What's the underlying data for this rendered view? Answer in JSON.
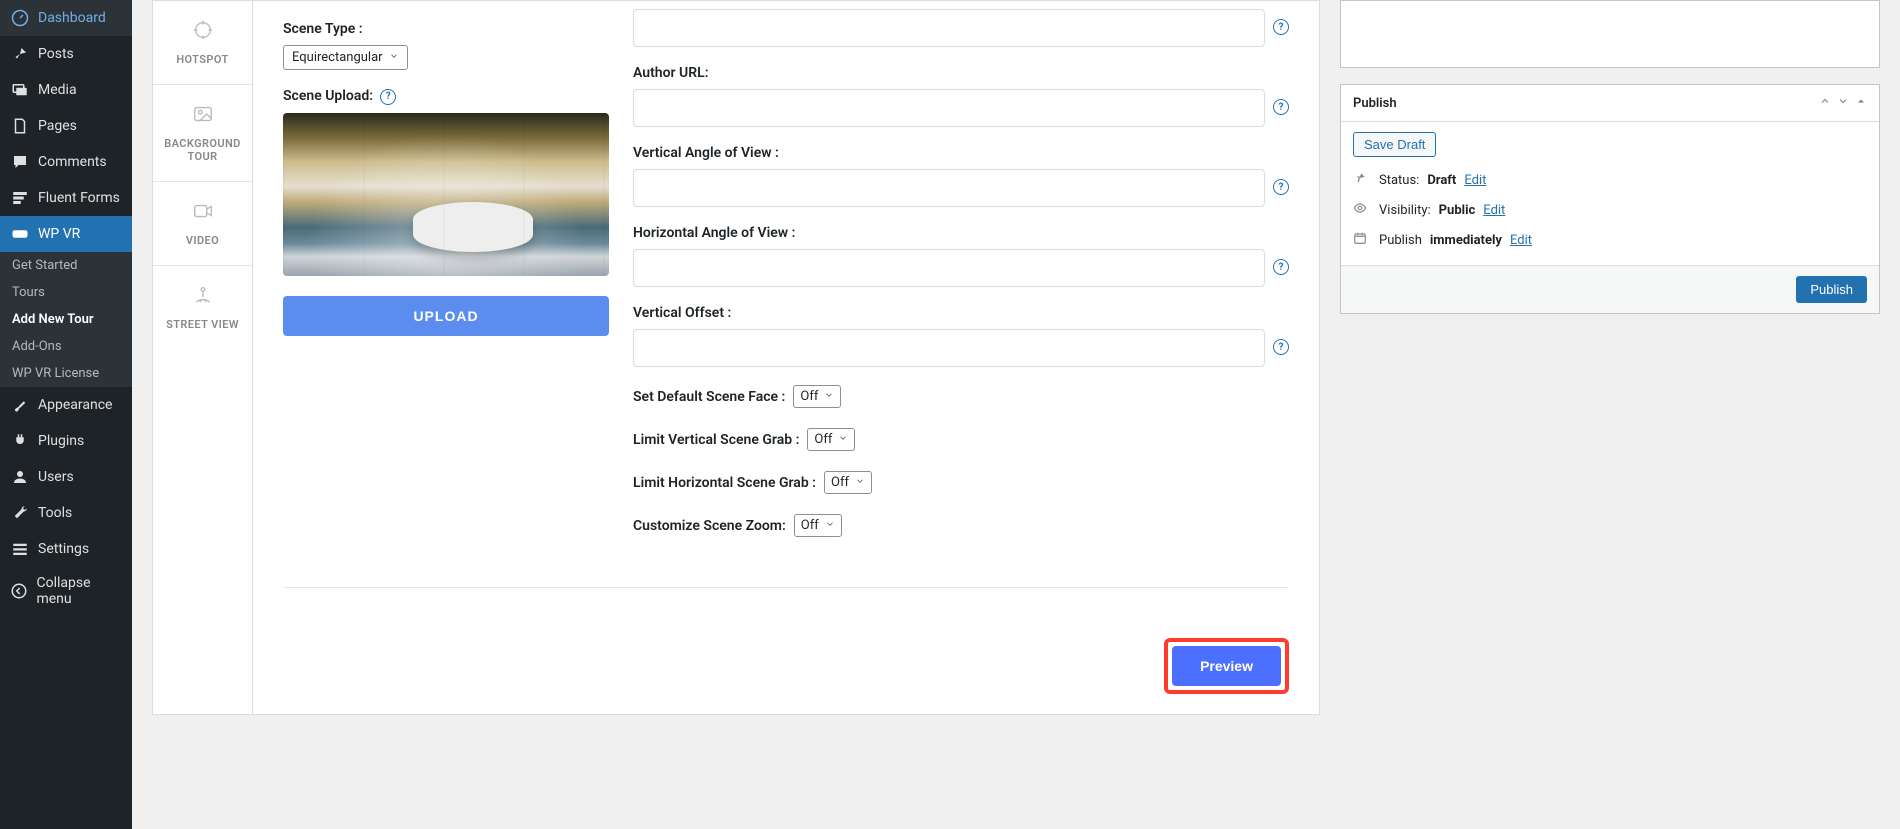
{
  "sidebar": {
    "items": [
      {
        "label": "Dashboard"
      },
      {
        "label": "Posts"
      },
      {
        "label": "Media"
      },
      {
        "label": "Pages"
      },
      {
        "label": "Comments"
      },
      {
        "label": "Fluent Forms"
      },
      {
        "label": "WP VR"
      },
      {
        "label": "Appearance"
      },
      {
        "label": "Plugins"
      },
      {
        "label": "Users"
      },
      {
        "label": "Tools"
      },
      {
        "label": "Settings"
      },
      {
        "label": "Collapse menu"
      }
    ],
    "wpvr_sub": [
      {
        "label": "Get Started"
      },
      {
        "label": "Tours"
      },
      {
        "label": "Add New Tour"
      },
      {
        "label": "Add-Ons"
      },
      {
        "label": "WP VR License"
      }
    ]
  },
  "vtabs": {
    "hotspot": "HOTSPOT",
    "background_tour": "BACKGROUND TOUR",
    "video": "VIDEO",
    "street_view": "STREET VIEW"
  },
  "form": {
    "scene_type_label": "Scene Type :",
    "scene_type_value": "Equirectangular",
    "scene_upload_label": "Scene Upload:",
    "upload_btn": "UPLOAD",
    "author_url_label": "Author URL:",
    "vaov_label": "Vertical Angle of View :",
    "haov_label": "Horizontal Angle of View :",
    "voffset_label": "Vertical Offset :",
    "default_face_label": "Set Default Scene Face :",
    "limit_vert_label": "Limit Vertical Scene Grab :",
    "limit_horiz_label": "Limit Horizontal Scene Grab :",
    "custom_zoom_label": "Customize Scene Zoom:",
    "off_value": "Off",
    "preview_btn": "Preview"
  },
  "publish": {
    "title": "Publish",
    "save_draft": "Save Draft",
    "status_label": "Status:",
    "status_value": "Draft",
    "edit": "Edit",
    "visibility_label": "Visibility:",
    "visibility_value": "Public",
    "publish_label": "Publish",
    "immediately": "immediately",
    "publish_btn": "Publish"
  }
}
